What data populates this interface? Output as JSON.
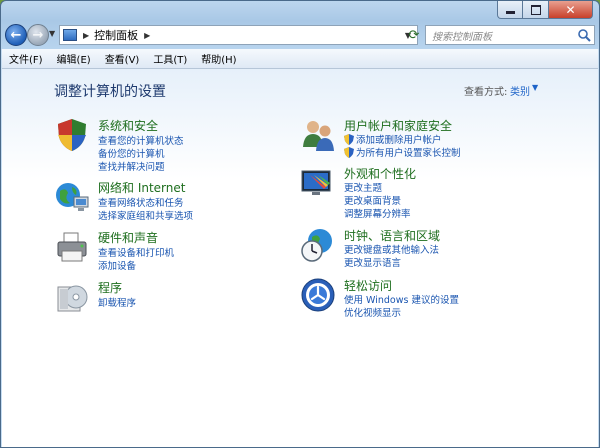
{
  "window": {
    "address_path": "控制面板",
    "search_placeholder": "搜索控制面板"
  },
  "menu": [
    "文件(F)",
    "编辑(E)",
    "查看(V)",
    "工具(T)",
    "帮助(H)"
  ],
  "header": {
    "title": "调整计算机的设置",
    "view_by_label": "查看方式:",
    "view_by_value": "类别"
  },
  "left_categories": [
    {
      "title": "系统和安全",
      "links": [
        "查看您的计算机状态",
        "备份您的计算机",
        "查找并解决问题"
      ]
    },
    {
      "title": "网络和 Internet",
      "links": [
        "查看网络状态和任务",
        "选择家庭组和共享选项"
      ]
    },
    {
      "title": "硬件和声音",
      "links": [
        "查看设备和打印机",
        "添加设备"
      ]
    },
    {
      "title": "程序",
      "links": [
        "卸载程序"
      ]
    }
  ],
  "right_categories": [
    {
      "title": "用户帐户和家庭安全",
      "links": [
        "添加或删除用户帐户",
        "为所有用户设置家长控制"
      ]
    },
    {
      "title": "外观和个性化",
      "links": [
        "更改主题",
        "更改桌面背景",
        "调整屏幕分辨率"
      ]
    },
    {
      "title": "时钟、语言和区域",
      "links": [
        "更改键盘或其他输入法",
        "更改显示语言"
      ]
    },
    {
      "title": "轻松访问",
      "links": [
        "使用 Windows 建议的设置",
        "优化视频显示"
      ]
    }
  ]
}
